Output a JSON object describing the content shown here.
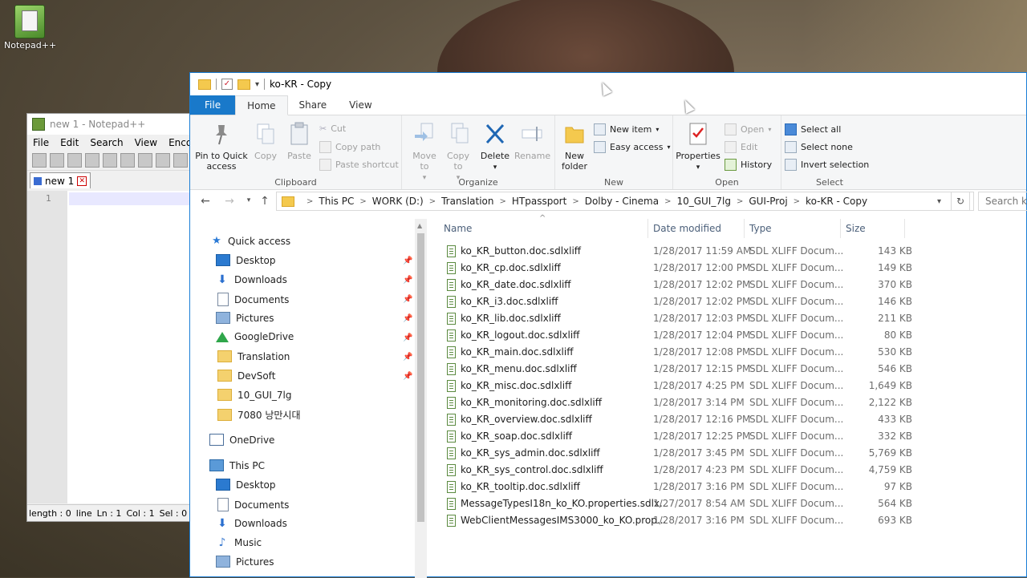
{
  "desktop": {
    "icon_label": "Notepad++"
  },
  "notepad": {
    "title": "new 1 - Notepad++",
    "menu": [
      "File",
      "Edit",
      "Search",
      "View",
      "Encodin"
    ],
    "tab_label": "new 1",
    "line_number": "1",
    "status": {
      "length": "length : 0",
      "lines": "line",
      "ln": "Ln : 1",
      "col": "Col : 1",
      "sel": "Sel : 0"
    }
  },
  "explorer": {
    "title": "ko-KR - Copy",
    "tabs": [
      "File",
      "Home",
      "Share",
      "View"
    ],
    "ribbon": {
      "clipboard": {
        "label": "Clipboard",
        "pin": "Pin to Quick access",
        "copy": "Copy",
        "paste": "Paste",
        "cut": "Cut",
        "copy_path": "Copy path",
        "paste_shortcut": "Paste shortcut"
      },
      "organize": {
        "label": "Organize",
        "move_to": "Move to",
        "copy_to": "Copy to",
        "delete": "Delete",
        "rename": "Rename"
      },
      "new": {
        "label": "New",
        "new_folder": "New folder",
        "new_item": "New item",
        "easy_access": "Easy access"
      },
      "open": {
        "label": "Open",
        "properties": "Properties",
        "open": "Open",
        "edit": "Edit",
        "history": "History"
      },
      "select": {
        "label": "Select",
        "select_all": "Select all",
        "select_none": "Select none",
        "invert": "Invert selection"
      }
    },
    "breadcrumb": [
      "This PC",
      "WORK (D:)",
      "Translation",
      "HTpassport",
      "Dolby - Cinema",
      "10_GUI_7lg",
      "GUI-Proj",
      "ko-KR - Copy"
    ],
    "search_placeholder": "Search ko",
    "nav": {
      "quick_access": "Quick access",
      "items": [
        "Desktop",
        "Downloads",
        "Documents",
        "Pictures",
        "GoogleDrive",
        "Translation",
        "DevSoft",
        "10_GUI_7lg",
        "7080 낭만시대"
      ],
      "onedrive": "OneDrive",
      "this_pc": "This PC",
      "pc_items": [
        "Desktop",
        "Documents",
        "Downloads",
        "Music",
        "Pictures"
      ]
    },
    "columns": {
      "name": "Name",
      "date": "Date modified",
      "type": "Type",
      "size": "Size"
    },
    "files": [
      {
        "name": "ko_KR_button.doc.sdlxliff",
        "date": "1/28/2017 11:59 AM",
        "type": "SDL XLIFF Docum...",
        "size": "143 KB"
      },
      {
        "name": "ko_KR_cp.doc.sdlxliff",
        "date": "1/28/2017 12:00 PM",
        "type": "SDL XLIFF Docum...",
        "size": "149 KB"
      },
      {
        "name": "ko_KR_date.doc.sdlxliff",
        "date": "1/28/2017 12:02 PM",
        "type": "SDL XLIFF Docum...",
        "size": "370 KB"
      },
      {
        "name": "ko_KR_i3.doc.sdlxliff",
        "date": "1/28/2017 12:02 PM",
        "type": "SDL XLIFF Docum...",
        "size": "146 KB"
      },
      {
        "name": "ko_KR_lib.doc.sdlxliff",
        "date": "1/28/2017 12:03 PM",
        "type": "SDL XLIFF Docum...",
        "size": "211 KB"
      },
      {
        "name": "ko_KR_logout.doc.sdlxliff",
        "date": "1/28/2017 12:04 PM",
        "type": "SDL XLIFF Docum...",
        "size": "80 KB"
      },
      {
        "name": "ko_KR_main.doc.sdlxliff",
        "date": "1/28/2017 12:08 PM",
        "type": "SDL XLIFF Docum...",
        "size": "530 KB"
      },
      {
        "name": "ko_KR_menu.doc.sdlxliff",
        "date": "1/28/2017 12:15 PM",
        "type": "SDL XLIFF Docum...",
        "size": "546 KB"
      },
      {
        "name": "ko_KR_misc.doc.sdlxliff",
        "date": "1/28/2017 4:25 PM",
        "type": "SDL XLIFF Docum...",
        "size": "1,649 KB"
      },
      {
        "name": "ko_KR_monitoring.doc.sdlxliff",
        "date": "1/28/2017 3:14 PM",
        "type": "SDL XLIFF Docum...",
        "size": "2,122 KB"
      },
      {
        "name": "ko_KR_overview.doc.sdlxliff",
        "date": "1/28/2017 12:16 PM",
        "type": "SDL XLIFF Docum...",
        "size": "433 KB"
      },
      {
        "name": "ko_KR_soap.doc.sdlxliff",
        "date": "1/28/2017 12:25 PM",
        "type": "SDL XLIFF Docum...",
        "size": "332 KB"
      },
      {
        "name": "ko_KR_sys_admin.doc.sdlxliff",
        "date": "1/28/2017 3:45 PM",
        "type": "SDL XLIFF Docum...",
        "size": "5,769 KB"
      },
      {
        "name": "ko_KR_sys_control.doc.sdlxliff",
        "date": "1/28/2017 4:23 PM",
        "type": "SDL XLIFF Docum...",
        "size": "4,759 KB"
      },
      {
        "name": "ko_KR_tooltip.doc.sdlxliff",
        "date": "1/28/2017 3:16 PM",
        "type": "SDL XLIFF Docum...",
        "size": "97 KB"
      },
      {
        "name": "MessageTypesI18n_ko_KO.properties.sdlx...",
        "date": "1/27/2017 8:54 AM",
        "type": "SDL XLIFF Docum...",
        "size": "564 KB"
      },
      {
        "name": "WebClientMessagesIMS3000_ko_KO.prop...",
        "date": "1/28/2017 3:16 PM",
        "type": "SDL XLIFF Docum...",
        "size": "693 KB"
      }
    ]
  }
}
